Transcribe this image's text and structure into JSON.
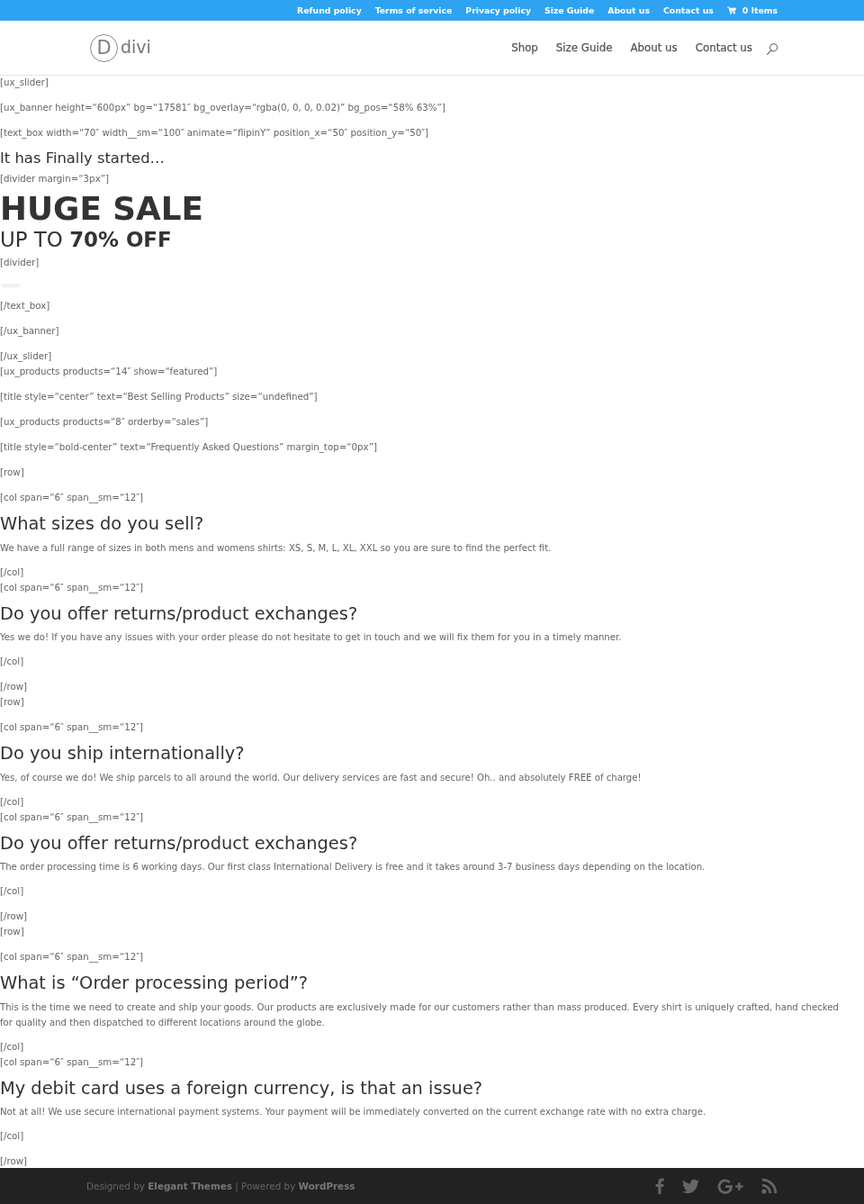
{
  "top_bar": {
    "links": [
      "Refund policy",
      "Terms of service",
      "Privacy policy",
      "Size Guide",
      "About us",
      "Contact us"
    ],
    "cart": "0 Items"
  },
  "header": {
    "logo": {
      "mark": "D",
      "wordmark": "divi"
    },
    "nav": [
      "Shop",
      "Size Guide",
      "About us",
      "Contact us"
    ]
  },
  "content": [
    {
      "kind": "code",
      "lines": [
        "[ux_slider]"
      ]
    },
    {
      "kind": "code",
      "lines": [
        "[ux_banner height=“600px” bg=“17581″ bg_overlay=“rgba(0, 0, 0, 0.02)” bg_pos=“58% 63%”]"
      ]
    },
    {
      "kind": "code",
      "lines": [
        "[text_box width=“70″ width__sm=“100″ animate=“flipinY” position_x=“50″ position_y=“50″]"
      ]
    },
    {
      "kind": "tagline",
      "text": "It has Finally started…"
    },
    {
      "kind": "code",
      "lines": [
        "[divider margin=“3px”]"
      ]
    },
    {
      "kind": "headline",
      "text": "HUGE SALE"
    },
    {
      "kind": "subheadline",
      "text": "UP TO **70% OFF**"
    },
    {
      "kind": "code",
      "lines": [
        "[divider]"
      ]
    },
    {
      "kind": "divider"
    },
    {
      "kind": "code",
      "lines": [
        "[/text_box]"
      ]
    },
    {
      "kind": "code",
      "lines": [
        "[/ux_banner]"
      ]
    },
    {
      "kind": "code",
      "lines": [
        "[/ux_slider]",
        "[ux_products products=“14″ show=“featured”]"
      ]
    },
    {
      "kind": "code",
      "lines": [
        "[title style=“center” text=“Best Selling Products” size=“undefined”]"
      ]
    },
    {
      "kind": "code",
      "lines": [
        "[ux_products products=“8″ orderby=“sales”]"
      ]
    },
    {
      "kind": "code",
      "lines": [
        "[title style=“bold-center” text=“Frequently Asked Questions” margin_top=“0px”]"
      ]
    },
    {
      "kind": "code",
      "lines": [
        "[row]"
      ]
    },
    {
      "kind": "code",
      "lines": [
        "[col span=“6″ span__sm=“12″]"
      ]
    },
    {
      "kind": "question",
      "text": "What sizes do you sell?"
    },
    {
      "kind": "answer",
      "text": "We have a full range of sizes in both mens and womens shirts: XS, S, M, L, XL, XXL so you are sure to find the perfect fit."
    },
    {
      "kind": "code",
      "lines": [
        "[/col]",
        "[col span=“6″ span__sm=“12″]"
      ]
    },
    {
      "kind": "question",
      "text": "Do you offer returns/product exchanges?"
    },
    {
      "kind": "answer",
      "text": "Yes we do! If you have any issues with your order please do not hesitate to get in touch and we will fix them for you in a timely manner."
    },
    {
      "kind": "code",
      "lines": [
        "[/col]"
      ]
    },
    {
      "kind": "code",
      "lines": [
        "[/row]",
        "[row]"
      ]
    },
    {
      "kind": "code",
      "lines": [
        "[col span=“6″ span__sm=“12″]"
      ]
    },
    {
      "kind": "question",
      "text": "Do you ship internationally?"
    },
    {
      "kind": "answer",
      "text": "Yes, of course we do! We ship parcels to all around the world. Our delivery services are fast and secure! Oh.. and absolutely FREE of charge!"
    },
    {
      "kind": "code",
      "lines": [
        "[/col]",
        "[col span=“6″ span__sm=“12″]"
      ]
    },
    {
      "kind": "question",
      "text": "Do you offer returns/product exchanges?"
    },
    {
      "kind": "answer",
      "text": "The order processing time is 6 working days. Our first class International Delivery is free and it takes around 3-7 business days depending on the location."
    },
    {
      "kind": "code",
      "lines": [
        "[/col]"
      ]
    },
    {
      "kind": "code",
      "lines": [
        "[/row]",
        "[row]"
      ]
    },
    {
      "kind": "code",
      "lines": [
        "[col span=“6″ span__sm=“12″]"
      ]
    },
    {
      "kind": "question",
      "text": "What is “Order processing period”?"
    },
    {
      "kind": "answer",
      "text": "This is the time we need to create and ship your goods. Our products are exclusively made for our customers rather than mass produced. Every shirt is uniquely crafted, hand checked for quality and then dispatched to different locations around the globe."
    },
    {
      "kind": "code",
      "lines": [
        "[/col]",
        "[col span=“6″ span__sm=“12″]"
      ]
    },
    {
      "kind": "question",
      "text": "My debit card uses a foreign currency, is that an issue?"
    },
    {
      "kind": "answer",
      "text": "Not at all! We use secure international payment systems. Your payment will be immediately converted on the current exchange rate with no extra charge."
    },
    {
      "kind": "code",
      "lines": [
        "[/col]"
      ]
    },
    {
      "kind": "code",
      "lines": [
        "[/row]"
      ]
    }
  ],
  "footer": {
    "credits": [
      {
        "kind": "text",
        "text": "Designed by "
      },
      {
        "kind": "link",
        "text": "Elegant Themes"
      },
      {
        "kind": "text",
        "text": " | Powered by "
      },
      {
        "kind": "link",
        "text": "WordPress"
      }
    ]
  }
}
